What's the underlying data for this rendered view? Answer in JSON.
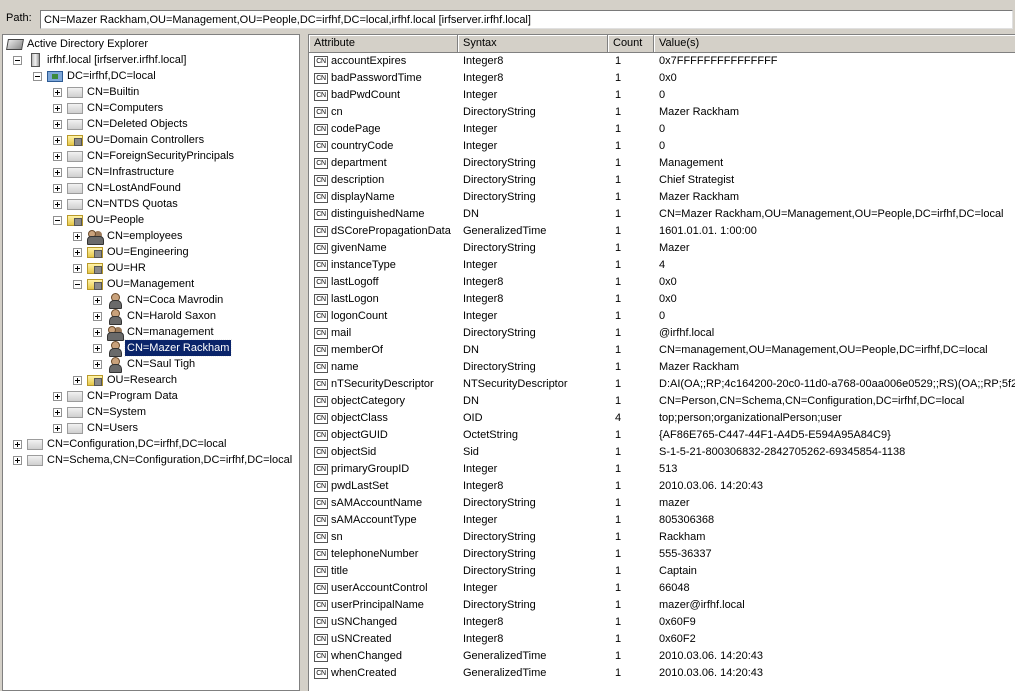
{
  "path": {
    "label": "Path:",
    "value": "CN=Mazer Rackham,OU=Management,OU=People,DC=irfhf,DC=local,irfhf.local [irfserver.irfhf.local]"
  },
  "tree": [
    {
      "label": "Active Directory Explorer",
      "icon": "ad-explorer-icon",
      "level": 0,
      "expander": "none"
    },
    {
      "label": "irfhf.local [irfserver.irfhf.local]",
      "icon": "server-icon",
      "level": 1,
      "expander": "minus"
    },
    {
      "label": "DC=irfhf,DC=local",
      "icon": "domain-icon",
      "level": 2,
      "expander": "minus"
    },
    {
      "label": "CN=Builtin",
      "icon": "folder-icon",
      "level": 3,
      "expander": "plus"
    },
    {
      "label": "CN=Computers",
      "icon": "folder-icon",
      "level": 3,
      "expander": "plus"
    },
    {
      "label": "CN=Deleted Objects",
      "icon": "folder-icon",
      "level": 3,
      "expander": "plus"
    },
    {
      "label": "OU=Domain Controllers",
      "icon": "ou-icon",
      "level": 3,
      "expander": "plus"
    },
    {
      "label": "CN=ForeignSecurityPrincipals",
      "icon": "folder-icon",
      "level": 3,
      "expander": "plus"
    },
    {
      "label": "CN=Infrastructure",
      "icon": "folder-icon",
      "level": 3,
      "expander": "plus"
    },
    {
      "label": "CN=LostAndFound",
      "icon": "folder-icon",
      "level": 3,
      "expander": "plus"
    },
    {
      "label": "CN=NTDS Quotas",
      "icon": "folder-icon",
      "level": 3,
      "expander": "plus"
    },
    {
      "label": "OU=People",
      "icon": "ou-icon",
      "level": 3,
      "expander": "minus"
    },
    {
      "label": "CN=employees",
      "icon": "group-icon",
      "level": 4,
      "expander": "plus"
    },
    {
      "label": "OU=Engineering",
      "icon": "ou-icon",
      "level": 4,
      "expander": "plus"
    },
    {
      "label": "OU=HR",
      "icon": "ou-icon",
      "level": 4,
      "expander": "plus"
    },
    {
      "label": "OU=Management",
      "icon": "ou-icon",
      "level": 4,
      "expander": "minus"
    },
    {
      "label": "CN=Coca Mavrodin",
      "icon": "user-icon",
      "level": 5,
      "expander": "plus"
    },
    {
      "label": "CN=Harold Saxon",
      "icon": "user-icon",
      "level": 5,
      "expander": "plus"
    },
    {
      "label": "CN=management",
      "icon": "group-icon",
      "level": 5,
      "expander": "plus"
    },
    {
      "label": "CN=Mazer Rackham",
      "icon": "user-icon",
      "level": 5,
      "expander": "plus",
      "selected": true
    },
    {
      "label": "CN=Saul Tigh",
      "icon": "user-icon",
      "level": 5,
      "expander": "plus"
    },
    {
      "label": "OU=Research",
      "icon": "ou-icon",
      "level": 4,
      "expander": "plus"
    },
    {
      "label": "CN=Program Data",
      "icon": "folder-icon",
      "level": 3,
      "expander": "plus"
    },
    {
      "label": "CN=System",
      "icon": "folder-icon",
      "level": 3,
      "expander": "plus"
    },
    {
      "label": "CN=Users",
      "icon": "folder-icon",
      "level": 3,
      "expander": "plus"
    },
    {
      "label": "CN=Configuration,DC=irfhf,DC=local",
      "icon": "folder-icon",
      "level": 1,
      "expander": "plus"
    },
    {
      "label": "CN=Schema,CN=Configuration,DC=irfhf,DC=local",
      "icon": "folder-icon",
      "level": 1,
      "expander": "plus"
    }
  ],
  "columns": [
    "Attribute",
    "Syntax",
    "Count",
    "Value(s)"
  ],
  "attr_icon_text": "CN",
  "attributes": [
    [
      "accountExpires",
      "Integer8",
      "1",
      "0x7FFFFFFFFFFFFFFF"
    ],
    [
      "badPasswordTime",
      "Integer8",
      "1",
      "0x0"
    ],
    [
      "badPwdCount",
      "Integer",
      "1",
      "0"
    ],
    [
      "cn",
      "DirectoryString",
      "1",
      "Mazer Rackham"
    ],
    [
      "codePage",
      "Integer",
      "1",
      "0"
    ],
    [
      "countryCode",
      "Integer",
      "1",
      "0"
    ],
    [
      "department",
      "DirectoryString",
      "1",
      "Management"
    ],
    [
      "description",
      "DirectoryString",
      "1",
      "Chief Strategist"
    ],
    [
      "displayName",
      "DirectoryString",
      "1",
      "Mazer Rackham"
    ],
    [
      "distinguishedName",
      "DN",
      "1",
      "CN=Mazer Rackham,OU=Management,OU=People,DC=irfhf,DC=local"
    ],
    [
      "dSCorePropagationData",
      "GeneralizedTime",
      "1",
      "1601.01.01. 1:00:00"
    ],
    [
      "givenName",
      "DirectoryString",
      "1",
      "Mazer"
    ],
    [
      "instanceType",
      "Integer",
      "1",
      "4"
    ],
    [
      "lastLogoff",
      "Integer8",
      "1",
      "0x0"
    ],
    [
      "lastLogon",
      "Integer8",
      "1",
      "0x0"
    ],
    [
      "logonCount",
      "Integer",
      "1",
      "0"
    ],
    [
      "mail",
      "DirectoryString",
      "1",
      "@irfhf.local"
    ],
    [
      "memberOf",
      "DN",
      "1",
      "CN=management,OU=Management,OU=People,DC=irfhf,DC=local"
    ],
    [
      "name",
      "DirectoryString",
      "1",
      "Mazer Rackham"
    ],
    [
      "nTSecurityDescriptor",
      "NTSecurityDescriptor",
      "1",
      "D:AI(OA;;RP;4c164200-20c0-11d0-a768-00aa006e0529;;RS)(OA;;RP;5f2"
    ],
    [
      "objectCategory",
      "DN",
      "1",
      "CN=Person,CN=Schema,CN=Configuration,DC=irfhf,DC=local"
    ],
    [
      "objectClass",
      "OID",
      "4",
      "top;person;organizationalPerson;user"
    ],
    [
      "objectGUID",
      "OctetString",
      "1",
      "{AF86E765-C447-44F1-A4D5-E594A95A84C9}"
    ],
    [
      "objectSid",
      "Sid",
      "1",
      "S-1-5-21-800306832-2842705262-69345854-1138"
    ],
    [
      "primaryGroupID",
      "Integer",
      "1",
      "513"
    ],
    [
      "pwdLastSet",
      "Integer8",
      "1",
      "2010.03.06. 14:20:43"
    ],
    [
      "sAMAccountName",
      "DirectoryString",
      "1",
      "mazer"
    ],
    [
      "sAMAccountType",
      "Integer",
      "1",
      "805306368"
    ],
    [
      "sn",
      "DirectoryString",
      "1",
      "Rackham"
    ],
    [
      "telephoneNumber",
      "DirectoryString",
      "1",
      "555-36337"
    ],
    [
      "title",
      "DirectoryString",
      "1",
      "Captain"
    ],
    [
      "userAccountControl",
      "Integer",
      "1",
      "66048"
    ],
    [
      "userPrincipalName",
      "DirectoryString",
      "1",
      "mazer@irfhf.local"
    ],
    [
      "uSNChanged",
      "Integer8",
      "1",
      "0x60F9"
    ],
    [
      "uSNCreated",
      "Integer8",
      "1",
      "0x60F2"
    ],
    [
      "whenChanged",
      "GeneralizedTime",
      "1",
      "2010.03.06. 14:20:43"
    ],
    [
      "whenCreated",
      "GeneralizedTime",
      "1",
      "2010.03.06. 14:20:43"
    ]
  ]
}
